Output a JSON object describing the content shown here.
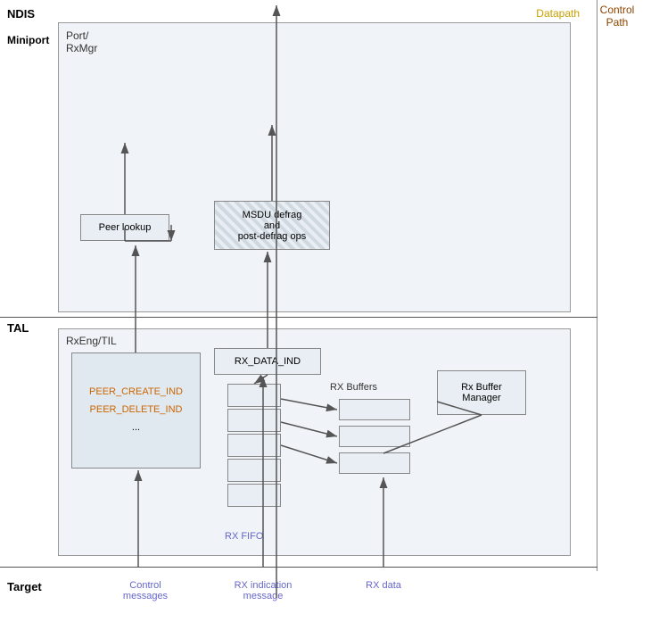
{
  "labels": {
    "ndis": "NDIS",
    "tal": "TAL",
    "target": "Target",
    "datapath": "Datapath",
    "control_path": "Control Path",
    "miniport": "Miniport",
    "port_rxmgr": "Port/\nRxMgr",
    "rxeng_til": "RxEng/TIL",
    "peer_lookup": "Peer lookup",
    "msdu_defrag": "MSDU defrag\nand\npost-defrag ops",
    "rx_data_ind": "RX_DATA_IND",
    "peer_create": "PEER_CREATE_IND\nPEER_DELETE_IND\n...",
    "rx_fifo": "RX FIFO",
    "rx_buffers": "RX Buffers",
    "rx_buf_mgr": "Rx Buffer\nManager",
    "control_messages": "Control\nmessages",
    "rx_indication": "RX indication\nmessage",
    "rx_data": "RX data"
  }
}
